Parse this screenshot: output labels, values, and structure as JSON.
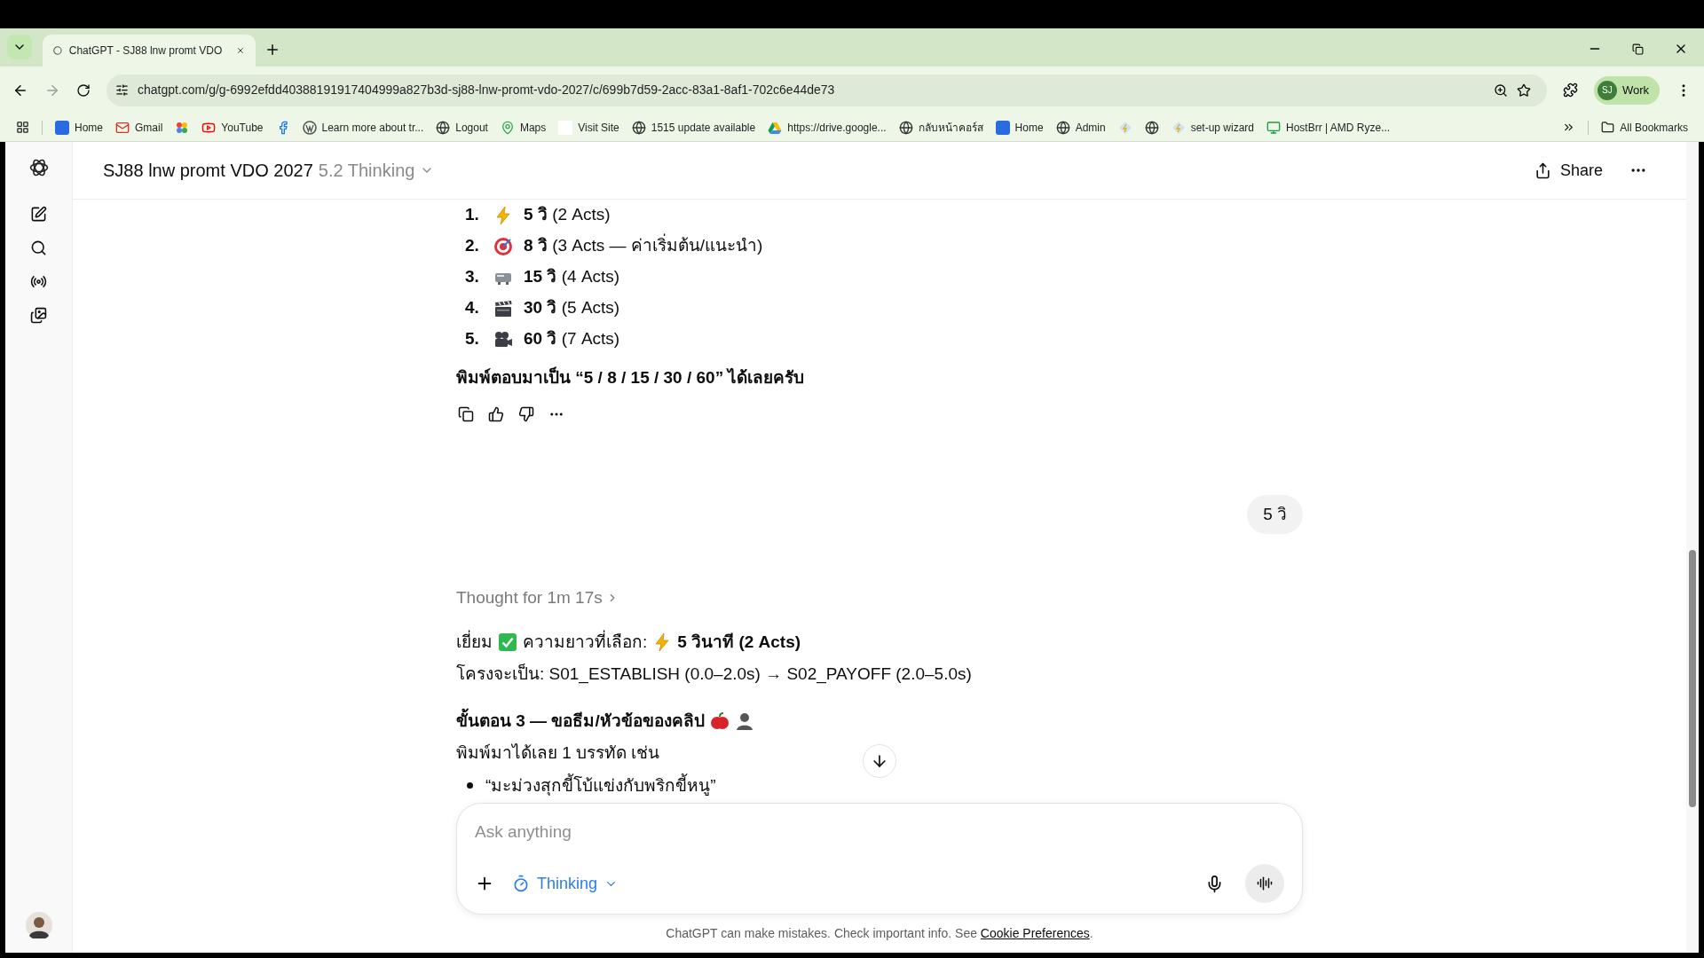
{
  "browser": {
    "tab": {
      "title": "ChatGPT - SJ88 lnw promt VDO",
      "selected": true
    },
    "url": "chatgpt.com/g/g-6992efdd40388191917404999a827b3d-sj88-lnw-promt-vdo-2027/c/699b7d59-2acc-83a1-8af1-702c6e44de73",
    "profile": {
      "initials": "SJ",
      "label": "Work"
    },
    "bookmarks": [
      {
        "kind": "app",
        "label": "Home"
      },
      {
        "kind": "mail",
        "label": "Gmail"
      },
      {
        "kind": "pinwheel"
      },
      {
        "kind": "youtube",
        "label": "YouTube"
      },
      {
        "kind": "facebook"
      },
      {
        "kind": "wordpress",
        "label": "Learn more about tr..."
      },
      {
        "kind": "globe",
        "label": "Logout"
      },
      {
        "kind": "pin",
        "label": "Maps"
      },
      {
        "kind": "blank",
        "label": "Visit Site"
      },
      {
        "kind": "globe",
        "label": "1515 update available"
      },
      {
        "kind": "drive",
        "label": "https://drive.google..."
      },
      {
        "kind": "globe",
        "label": "กลับหน้าคอร์ส"
      },
      {
        "kind": "app",
        "label": "Home"
      },
      {
        "kind": "globe",
        "label": "Admin"
      },
      {
        "kind": "diamond"
      },
      {
        "kind": "globe"
      },
      {
        "kind": "diamond",
        "label": "set-up wizard"
      },
      {
        "kind": "monitor",
        "label": "HostBrr | AMD Ryze..."
      }
    ],
    "all_bookmarks": "All Bookmarks"
  },
  "header": {
    "title": "SJ88 lnw promt VDO 2027",
    "model": "5.2 Thinking",
    "share": "Share"
  },
  "options": [
    {
      "kind": "bolt",
      "number": "1.",
      "value": "5 วิ",
      "detail": "(2 Acts)"
    },
    {
      "kind": "target",
      "number": "2.",
      "value": "8 วิ",
      "detail": "(3 Acts — ค่าเริ่มต้น/แนะนำ)"
    },
    {
      "kind": "projector",
      "number": "3.",
      "value": "15 วิ",
      "detail": "(4 Acts)"
    },
    {
      "kind": "clapper",
      "number": "4.",
      "value": "30 วิ",
      "detail": "(5 Acts)"
    },
    {
      "kind": "camera",
      "number": "5.",
      "value": "60 วิ",
      "detail": "(7 Acts)"
    }
  ],
  "prompt_line": "พิมพ์ตอบมาเป็น “5 / 8 / 15 / 30 / 60” ได้เลยครับ",
  "user_message": "5 วิ",
  "thought": "Thought for 1m 17s",
  "reply": {
    "line_1": "เยี่ยม",
    "line_1b": "ความยาวที่เลือก:",
    "line_1c": "5 วินาที (2 Acts)",
    "line_2": "โครงจะเป็น: S01_ESTABLISH (0.0–2.0s) → S02_PAYOFF (2.0–5.0s)",
    "heading": "ขั้นตอน 3 — ขอธีม/หัวข้อของคลิป",
    "line_3": "พิมพ์มาได้เลย 1 บรรทัด เช่น",
    "bullet": "“มะม่วงสุกขี้โบ้แข่งกับพริกขี้หนู”"
  },
  "composer": {
    "placeholder": "Ask anything",
    "mode": "Thinking"
  },
  "footer": {
    "text": "ChatGPT can make mistakes. Check important info. See",
    "link": "Cookie Preferences",
    "end": "."
  }
}
